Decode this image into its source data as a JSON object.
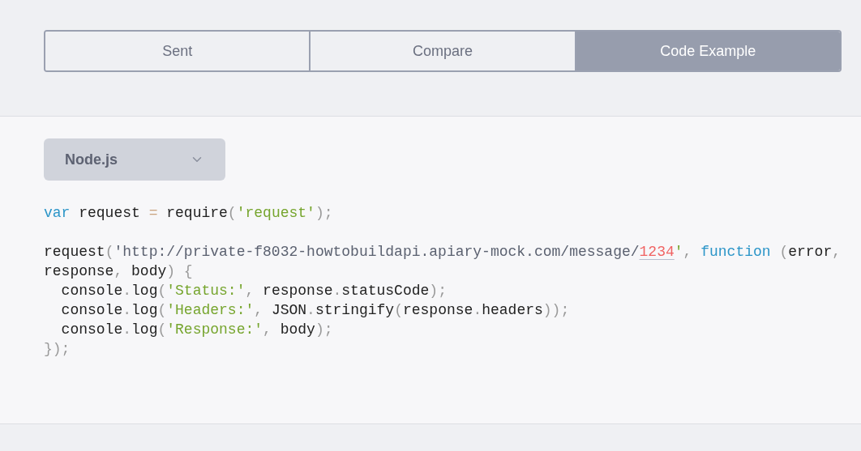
{
  "tabs": [
    {
      "label": "Sent",
      "selected": false
    },
    {
      "label": "Compare",
      "selected": false
    },
    {
      "label": "Code Example",
      "selected": true
    }
  ],
  "language_select": {
    "value": "Node.js"
  },
  "code_blocks": [
    [
      [
        {
          "kind": "keyword",
          "text": "var"
        },
        {
          "kind": "plain",
          "text": " request "
        },
        {
          "kind": "operator",
          "text": "="
        },
        {
          "kind": "plain",
          "text": " require"
        },
        {
          "kind": "punct",
          "text": "("
        },
        {
          "kind": "string",
          "text": "'request'"
        },
        {
          "kind": "punct",
          "text": ");"
        }
      ]
    ],
    [
      [
        {
          "kind": "plain",
          "text": "request"
        },
        {
          "kind": "punct",
          "text": "("
        },
        {
          "kind": "url",
          "text": "'http://private-f8032-howtobuildapi.apiary-mock.com/message/"
        },
        {
          "kind": "param",
          "text": "1234"
        },
        {
          "kind": "string",
          "text": "'"
        },
        {
          "kind": "punct",
          "text": ", "
        },
        {
          "kind": "keyword",
          "text": "function"
        },
        {
          "kind": "punct",
          "text": " ("
        },
        {
          "kind": "plain",
          "text": "error"
        },
        {
          "kind": "punct",
          "text": ","
        }
      ],
      [
        {
          "kind": "plain",
          "text": "response"
        },
        {
          "kind": "punct",
          "text": ", "
        },
        {
          "kind": "plain",
          "text": "body"
        },
        {
          "kind": "punct",
          "text": ") {"
        }
      ],
      [
        {
          "kind": "plain",
          "text": "  console"
        },
        {
          "kind": "punct",
          "text": "."
        },
        {
          "kind": "plain",
          "text": "log"
        },
        {
          "kind": "punct",
          "text": "("
        },
        {
          "kind": "string",
          "text": "'Status:'"
        },
        {
          "kind": "punct",
          "text": ", "
        },
        {
          "kind": "plain",
          "text": "response"
        },
        {
          "kind": "punct",
          "text": "."
        },
        {
          "kind": "plain",
          "text": "statusCode"
        },
        {
          "kind": "punct",
          "text": ");"
        }
      ],
      [
        {
          "kind": "plain",
          "text": "  console"
        },
        {
          "kind": "punct",
          "text": "."
        },
        {
          "kind": "plain",
          "text": "log"
        },
        {
          "kind": "punct",
          "text": "("
        },
        {
          "kind": "string",
          "text": "'Headers:'"
        },
        {
          "kind": "punct",
          "text": ", "
        },
        {
          "kind": "plain",
          "text": "JSON"
        },
        {
          "kind": "punct",
          "text": "."
        },
        {
          "kind": "plain",
          "text": "stringify"
        },
        {
          "kind": "punct",
          "text": "("
        },
        {
          "kind": "plain",
          "text": "response"
        },
        {
          "kind": "punct",
          "text": "."
        },
        {
          "kind": "plain",
          "text": "headers"
        },
        {
          "kind": "punct",
          "text": "));"
        }
      ],
      [
        {
          "kind": "plain",
          "text": "  console"
        },
        {
          "kind": "punct",
          "text": "."
        },
        {
          "kind": "plain",
          "text": "log"
        },
        {
          "kind": "punct",
          "text": "("
        },
        {
          "kind": "string",
          "text": "'Response:'"
        },
        {
          "kind": "punct",
          "text": ", "
        },
        {
          "kind": "plain",
          "text": "body"
        },
        {
          "kind": "punct",
          "text": ");"
        }
      ],
      [
        {
          "kind": "punct",
          "text": "});"
        }
      ]
    ]
  ]
}
